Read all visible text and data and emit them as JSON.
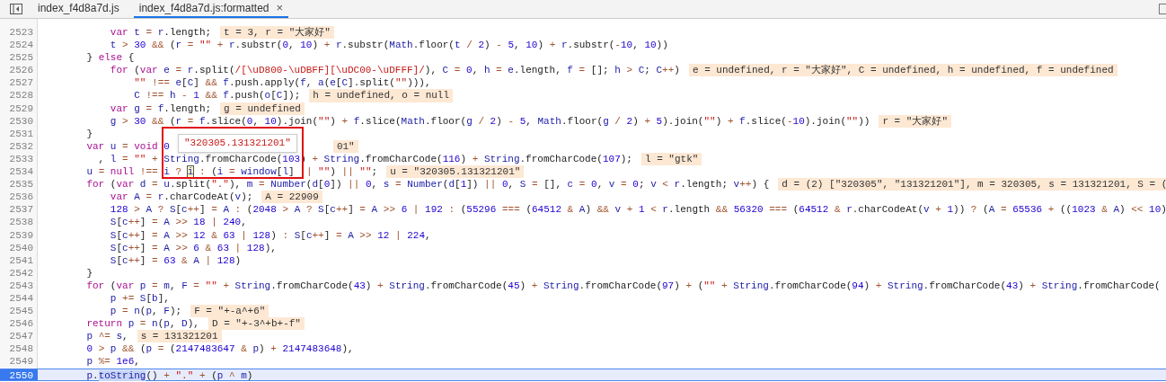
{
  "tabs": [
    {
      "label": "index_f4d8a7d.js",
      "selected": false
    },
    {
      "label": "index_f4d8a7d.js:formatted",
      "selected": true,
      "close_icon": "×"
    }
  ],
  "tooltip": {
    "value": "\"320305.131321201\""
  },
  "lines": [
    {
      "number": "2523",
      "code": "        var t = r.length;",
      "annotation": "t = 3, r = \"大家好\"",
      "current": false
    },
    {
      "number": "2524",
      "code": "        t > 30 && (r = \"\" + r.substr(0, 10) + r.substr(Math.floor(t / 2) - 5, 10) + r.substr(-10, 10))",
      "current": false
    },
    {
      "number": "2525",
      "code": "    } else {",
      "current": false
    },
    {
      "number": "2526",
      "code": "        for (var e = r.split(/[\\uD800-\\uDBFF][\\uDC00-\\uDFFF]/), C = 0, h = e.length, f = []; h > C; C++)",
      "annotation": "e = undefined, r = \"大家好\", C = undefined, h = undefined, f = undefined",
      "current": false
    },
    {
      "number": "2527",
      "code": "            \"\" !== e[C] && f.push.apply(f, a(e[C].split(\"\"))),",
      "current": false
    },
    {
      "number": "2528",
      "code": "            C !== h - 1 && f.push(o[C]);",
      "annotation": "h = undefined, o = null",
      "current": false
    },
    {
      "number": "2529",
      "code": "        var g = f.length;",
      "annotation": "g = undefined",
      "current": false
    },
    {
      "number": "2530",
      "code": "        g > 30 && (r = f.slice(0, 10).join(\"\") + f.slice(Math.floor(g / 2) - 5, Math.floor(g / 2) + 5).join(\"\") + f.slice(-10).join(\"\"))",
      "annotation": "r = \"大家好\"",
      "current": false
    },
    {
      "number": "2531",
      "code": "    }",
      "current": false
    },
    {
      "number": "2532",
      "code": "    var u = void 0",
      "annotation": "01\"",
      "covered": true,
      "current": false
    },
    {
      "number": "2533",
      "code": "      , l = \"\" + String.fromCharCode(103) + String.fromCharCode(116) + String.fromCharCode(107);",
      "annotation": "l = \"gtk\"",
      "current": false
    },
    {
      "number": "2534",
      "segments": [
        {
          "text": "    u = null !== i ? ",
          "kind": "plain"
        },
        {
          "text": "i",
          "kind": "hover"
        },
        {
          "text": " : (i = window[l] || \"\") || \"\";",
          "kind": "plain"
        }
      ],
      "annotation": "u = \"320305.131321201\"",
      "current": false
    },
    {
      "number": "2535",
      "code": "    for (var d = u.split(\".\"), m = Number(d[0]) || 0, s = Number(d[1]) || 0, S = [], c = 0, v = 0; v < r.length; v++) {",
      "annotation": "d = (2) [\"320305\", \"131321201\"], m = 320305, s = 131321201, S = (",
      "current": false
    },
    {
      "number": "2536",
      "code": "        var A = r.charCodeAt(v);",
      "annotation": "A = 22909",
      "current": false
    },
    {
      "number": "2537",
      "code": "        128 > A ? S[c++] = A : (2048 > A ? S[c++] = A >> 6 | 192 : (55296 === (64512 & A) && v + 1 < r.length && 56320 === (64512 & r.charCodeAt(v + 1)) ? (A = 65536 + ((1023 & A) << 10)",
      "current": false
    },
    {
      "number": "2538",
      "code": "        S[c++] = A >> 18 | 240,",
      "current": false
    },
    {
      "number": "2539",
      "code": "        S[c++] = A >> 12 & 63 | 128) : S[c++] = A >> 12 | 224,",
      "current": false
    },
    {
      "number": "2540",
      "code": "        S[c++] = A >> 6 & 63 | 128),",
      "current": false
    },
    {
      "number": "2541",
      "code": "        S[c++] = 63 & A | 128)",
      "current": false
    },
    {
      "number": "2542",
      "code": "    }",
      "current": false
    },
    {
      "number": "2543",
      "code": "    for (var p = m, F = \"\" + String.fromCharCode(43) + String.fromCharCode(45) + String.fromCharCode(97) + (\"\" + String.fromCharCode(94) + String.fromCharCode(43) + String.fromCharCode(",
      "current": false
    },
    {
      "number": "2544",
      "code": "        p += S[b],",
      "current": false
    },
    {
      "number": "2545",
      "code": "        p = n(p, F);",
      "annotation": "F = \"+-a^+6\"",
      "current": false
    },
    {
      "number": "2546",
      "code": "    return p = n(p, D),",
      "annotation": "D = \"+-3^+b+-f\"",
      "current": false
    },
    {
      "number": "2547",
      "code": "    p ^= s,",
      "annotation": "s = 131321201",
      "current": false
    },
    {
      "number": "2548",
      "code": "    0 > p && (p = (2147483647 & p) + 2147483648),",
      "current": false
    },
    {
      "number": "2549",
      "code": "    p %= 1e6,",
      "current": false
    },
    {
      "number": "2550",
      "segments": [
        {
          "text": "    p.",
          "kind": "plain"
        },
        {
          "text": "toString",
          "kind": "selection"
        },
        {
          "text": "() + \".\" + (p ^ m)",
          "kind": "plain"
        }
      ],
      "current": true
    }
  ]
}
